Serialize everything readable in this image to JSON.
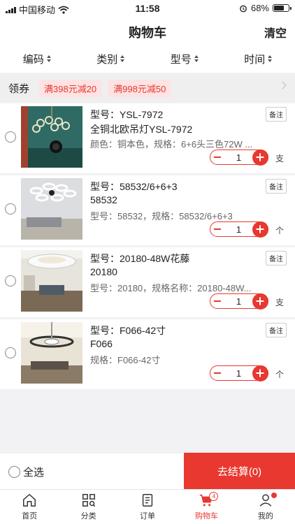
{
  "status": {
    "carrier": "中国移动",
    "time": "11:58",
    "battery": "68%"
  },
  "header": {
    "title": "购物车",
    "clear_label": "清空"
  },
  "sort": {
    "items": [
      {
        "label": "编码"
      },
      {
        "label": "类别"
      },
      {
        "label": "型号"
      },
      {
        "label": "时间"
      }
    ]
  },
  "coupons": {
    "label": "领券",
    "items": [
      "满398元减20",
      "满998元减50"
    ]
  },
  "items": [
    {
      "model": "型号：YSL-7972",
      "name": "全铜北欧吊灯YSL-7972",
      "spec": "颜色：铜本色，规格：6+6头三色72W ...",
      "note": "备注",
      "qty": "1",
      "unit": "支"
    },
    {
      "model": "型号：58532/6+6+3",
      "name": "58532",
      "spec": "型号：58532，规格：58532/6+6+3",
      "note": "备注",
      "qty": "1",
      "unit": "个"
    },
    {
      "model": "型号：20180-48W花藤",
      "name": "20180",
      "spec": "型号：20180，规格名称：20180-48W...",
      "note": "备注",
      "qty": "1",
      "unit": "支"
    },
    {
      "model": "型号：F066-42寸",
      "name": "F066",
      "spec": "规格：F066-42寸",
      "note": "备注",
      "qty": "1",
      "unit": "个"
    }
  ],
  "footer": {
    "select_all": "全选",
    "checkout": "去结算(0)"
  },
  "tabbar": {
    "tabs": [
      {
        "label": "首页"
      },
      {
        "label": "分类"
      },
      {
        "label": "订单"
      },
      {
        "label": "购物车",
        "badge": "4"
      },
      {
        "label": "我的"
      }
    ]
  },
  "colors": {
    "accent": "#e8382f",
    "background": "#f2f2f4",
    "coupon_bg": "#fde3e3"
  }
}
